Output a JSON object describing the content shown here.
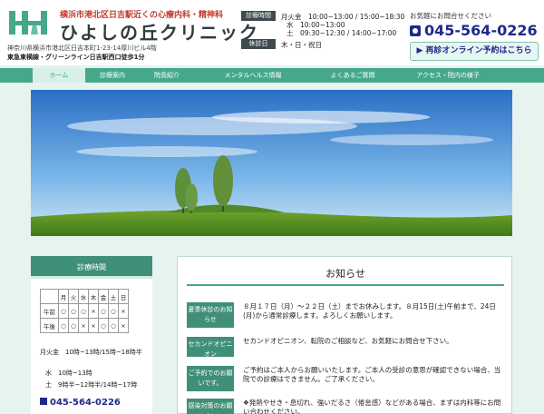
{
  "header": {
    "tagline": "横浜市港北区日吉駅近くの心療内科・精神科",
    "clinic_name": "ひよしの丘クリニック",
    "address": "神奈川県横浜市港北区日吉本町1-23-14厚川ビル4階",
    "access": "東急東横線・グリーンライン日吉駅西口徒歩1分"
  },
  "hours": {
    "tag_hours": "診療時間",
    "tag_closed": "休診日",
    "rows": [
      "月火金　10:00~13:00 / 15:00~18:30",
      "水　10:00~13:00",
      "土　09:30~12:30 / 14:00~17:00"
    ],
    "closed": "木・日・祝日"
  },
  "contact": {
    "label": "お気軽にお問合せください",
    "phone": "045-564-0226",
    "reserve": "再診オンライン予約はこちら"
  },
  "nav": {
    "items": [
      "ホーム",
      "診療案内",
      "院長紹介",
      "メンタルヘルス情報",
      "よくあるご質問",
      "アクセス・院内の様子"
    ]
  },
  "sidebar": {
    "title": "診療時間",
    "days": [
      "",
      "月",
      "火",
      "水",
      "木",
      "金",
      "土",
      "日"
    ],
    "rows": [
      [
        "午前",
        "○",
        "○",
        "○",
        "×",
        "○",
        "○",
        "×"
      ],
      [
        "午後",
        "○",
        "○",
        "×",
        "×",
        "○",
        "○",
        "×"
      ]
    ],
    "hours": [
      "月火金　10時~13時/15時~18時半",
      "水　10時~13時",
      "土　9時半~12時半/14時~17時"
    ],
    "phone": "045-564-0226"
  },
  "news": {
    "title": "お知らせ",
    "items": [
      {
        "label": "夏季休診のお知らせ",
        "body": "８月１７日（月）〜２２日（土）までお休みします。８月15日(土)午前まで、24日(月)から通常診療します。よろしくお願いします。"
      },
      {
        "label": "セカンドオピニオン",
        "body": "セカンドオピニオン、転院のご相談など、お気軽にお問合せ下さい。"
      },
      {
        "label": "ご予約でのお願いです。",
        "body": "ご予約はご本人からお願いいたします。ご本人の受診の意思が確認できない場合、当院での診療はできません。ご了承ください。"
      },
      {
        "label": "感染対策のお願い",
        "body": "❖発熱やせき・息切れ、強いだるさ（倦怠感）などがある場合、まずは内科等にお問い合わせください。"
      }
    ]
  },
  "colors": {
    "accent_green": "#46a88b",
    "dark_green": "#3f8f79",
    "phone_blue": "#1e2a8a",
    "tagline_red": "#c0392b"
  }
}
